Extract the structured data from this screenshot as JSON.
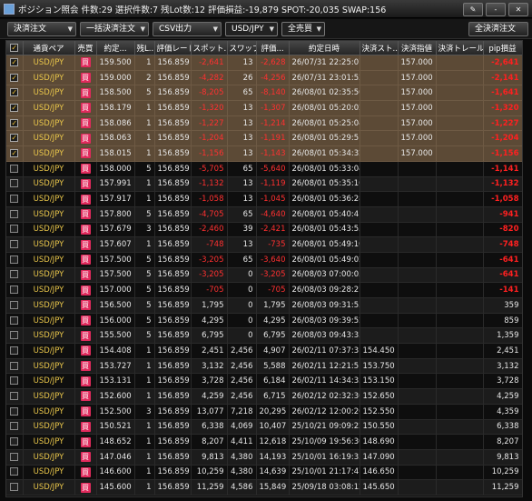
{
  "window": {
    "title": "ポジション照会  件数:29  選択件数:7  残Lot数:12  評価損益:-19,879  SPOT:-20,035  SWAP:156",
    "buttons": [
      "✎",
      "-",
      "✕"
    ]
  },
  "toolbar": {
    "settle_order": "決済注文",
    "bulk_settle": "一括決済注文",
    "csv_export": "CSV出力",
    "pair_filter": "USD/JPY",
    "side_filter": "全売買",
    "all_settle": "全決済注文"
  },
  "columns": [
    "",
    "通貨ペア",
    "売買",
    "約定...",
    "残L...",
    "評価レート",
    "スポット...",
    "スワップ",
    "評価...",
    "約定日時",
    "決済スト...",
    "決済指値",
    "決済トレール",
    "pip損益"
  ],
  "rows": [
    {
      "sel": true,
      "pair": "USD/JPY",
      "side": "買",
      "price": "159.500",
      "lot": "1",
      "rate": "156.859",
      "spot": "-2,641",
      "swap": "13",
      "eval": "-2,628",
      "date": "26/07/31 22:25:07",
      "stop": "",
      "limit": "157.000",
      "trail": "",
      "pip": "-2,641"
    },
    {
      "sel": true,
      "pair": "USD/JPY",
      "side": "買",
      "price": "159.000",
      "lot": "2",
      "rate": "156.859",
      "spot": "-4,282",
      "swap": "26",
      "eval": "-4,256",
      "date": "26/07/31 23:01:52",
      "stop": "",
      "limit": "157.000",
      "trail": "",
      "pip": "-2,141"
    },
    {
      "sel": true,
      "pair": "USD/JPY",
      "side": "買",
      "price": "158.500",
      "lot": "5",
      "rate": "156.859",
      "spot": "-8,205",
      "swap": "65",
      "eval": "-8,140",
      "date": "26/08/01 02:35:50",
      "stop": "",
      "limit": "157.000",
      "trail": "",
      "pip": "-1,641"
    },
    {
      "sel": true,
      "pair": "USD/JPY",
      "side": "買",
      "price": "158.179",
      "lot": "1",
      "rate": "156.859",
      "spot": "-1,320",
      "swap": "13",
      "eval": "-1,307",
      "date": "26/08/01 05:20:02",
      "stop": "",
      "limit": "157.000",
      "trail": "",
      "pip": "-1,320"
    },
    {
      "sel": true,
      "pair": "USD/JPY",
      "side": "買",
      "price": "158.086",
      "lot": "1",
      "rate": "156.859",
      "spot": "-1,227",
      "swap": "13",
      "eval": "-1,214",
      "date": "26/08/01 05:25:04",
      "stop": "",
      "limit": "157.000",
      "trail": "",
      "pip": "-1,227"
    },
    {
      "sel": true,
      "pair": "USD/JPY",
      "side": "買",
      "price": "158.063",
      "lot": "1",
      "rate": "156.859",
      "spot": "-1,204",
      "swap": "13",
      "eval": "-1,191",
      "date": "26/08/01 05:29:51",
      "stop": "",
      "limit": "157.000",
      "trail": "",
      "pip": "-1,204"
    },
    {
      "sel": true,
      "pair": "USD/JPY",
      "side": "買",
      "price": "158.015",
      "lot": "1",
      "rate": "156.859",
      "spot": "-1,156",
      "swap": "13",
      "eval": "-1,143",
      "date": "26/08/01 05:34:32",
      "stop": "",
      "limit": "157.000",
      "trail": "",
      "pip": "-1,156"
    },
    {
      "sel": false,
      "pair": "USD/JPY",
      "side": "買",
      "price": "158.000",
      "lot": "5",
      "rate": "156.859",
      "spot": "-5,705",
      "swap": "65",
      "eval": "-5,640",
      "date": "26/08/01 05:33:04",
      "stop": "",
      "limit": "",
      "trail": "",
      "pip": "-1,141"
    },
    {
      "sel": false,
      "pair": "USD/JPY",
      "side": "買",
      "price": "157.991",
      "lot": "1",
      "rate": "156.859",
      "spot": "-1,132",
      "swap": "13",
      "eval": "-1,119",
      "date": "26/08/01 05:35:16",
      "stop": "",
      "limit": "",
      "trail": "",
      "pip": "-1,132"
    },
    {
      "sel": false,
      "pair": "USD/JPY",
      "side": "買",
      "price": "157.917",
      "lot": "1",
      "rate": "156.859",
      "spot": "-1,058",
      "swap": "13",
      "eval": "-1,045",
      "date": "26/08/01 05:36:28",
      "stop": "",
      "limit": "",
      "trail": "",
      "pip": "-1,058"
    },
    {
      "sel": false,
      "pair": "USD/JPY",
      "side": "買",
      "price": "157.800",
      "lot": "5",
      "rate": "156.859",
      "spot": "-4,705",
      "swap": "65",
      "eval": "-4,640",
      "date": "26/08/01 05:40:41",
      "stop": "",
      "limit": "",
      "trail": "",
      "pip": "-941"
    },
    {
      "sel": false,
      "pair": "USD/JPY",
      "side": "買",
      "price": "157.679",
      "lot": "3",
      "rate": "156.859",
      "spot": "-2,460",
      "swap": "39",
      "eval": "-2,421",
      "date": "26/08/01 05:43:53",
      "stop": "",
      "limit": "",
      "trail": "",
      "pip": "-820"
    },
    {
      "sel": false,
      "pair": "USD/JPY",
      "side": "買",
      "price": "157.607",
      "lot": "1",
      "rate": "156.859",
      "spot": "-748",
      "swap": "13",
      "eval": "-735",
      "date": "26/08/01 05:49:10",
      "stop": "",
      "limit": "",
      "trail": "",
      "pip": "-748"
    },
    {
      "sel": false,
      "pair": "USD/JPY",
      "side": "買",
      "price": "157.500",
      "lot": "5",
      "rate": "156.859",
      "spot": "-3,205",
      "swap": "65",
      "eval": "-3,640",
      "date": "26/08/01 05:49:02",
      "stop": "",
      "limit": "",
      "trail": "",
      "pip": "-641"
    },
    {
      "sel": false,
      "pair": "USD/JPY",
      "side": "買",
      "price": "157.500",
      "lot": "5",
      "rate": "156.859",
      "spot": "-3,205",
      "swap": "0",
      "eval": "-3,205",
      "date": "26/08/03 07:00:05",
      "stop": "",
      "limit": "",
      "trail": "",
      "pip": "-641"
    },
    {
      "sel": false,
      "pair": "USD/JPY",
      "side": "買",
      "price": "157.000",
      "lot": "5",
      "rate": "156.859",
      "spot": "-705",
      "swap": "0",
      "eval": "-705",
      "date": "26/08/03 09:28:27",
      "stop": "",
      "limit": "",
      "trail": "",
      "pip": "-141"
    },
    {
      "sel": false,
      "pair": "USD/JPY",
      "side": "買",
      "price": "156.500",
      "lot": "5",
      "rate": "156.859",
      "spot": "1,795",
      "swap": "0",
      "eval": "1,795",
      "date": "26/08/03 09:31:53",
      "stop": "",
      "limit": "",
      "trail": "",
      "pip": "359"
    },
    {
      "sel": false,
      "pair": "USD/JPY",
      "side": "買",
      "price": "156.000",
      "lot": "5",
      "rate": "156.859",
      "spot": "4,295",
      "swap": "0",
      "eval": "4,295",
      "date": "26/08/03 09:39:52",
      "stop": "",
      "limit": "",
      "trail": "",
      "pip": "859"
    },
    {
      "sel": false,
      "pair": "USD/JPY",
      "side": "買",
      "price": "155.500",
      "lot": "5",
      "rate": "156.859",
      "spot": "6,795",
      "swap": "0",
      "eval": "6,795",
      "date": "26/08/03 09:43:33",
      "stop": "",
      "limit": "",
      "trail": "",
      "pip": "1,359"
    },
    {
      "sel": false,
      "pair": "USD/JPY",
      "side": "買",
      "price": "154.408",
      "lot": "1",
      "rate": "156.859",
      "spot": "2,451",
      "swap": "2,456",
      "eval": "4,907",
      "date": "26/02/11 07:37:31",
      "stop": "154.450",
      "limit": "",
      "trail": "",
      "pip": "2,451"
    },
    {
      "sel": false,
      "pair": "USD/JPY",
      "side": "買",
      "price": "153.727",
      "lot": "1",
      "rate": "156.859",
      "spot": "3,132",
      "swap": "2,456",
      "eval": "5,588",
      "date": "26/02/11 12:21:51",
      "stop": "153.750",
      "limit": "",
      "trail": "",
      "pip": "3,132"
    },
    {
      "sel": false,
      "pair": "USD/JPY",
      "side": "買",
      "price": "153.131",
      "lot": "1",
      "rate": "156.859",
      "spot": "3,728",
      "swap": "2,456",
      "eval": "6,184",
      "date": "26/02/11 14:34:35",
      "stop": "153.150",
      "limit": "",
      "trail": "",
      "pip": "3,728"
    },
    {
      "sel": false,
      "pair": "USD/JPY",
      "side": "買",
      "price": "152.600",
      "lot": "1",
      "rate": "156.859",
      "spot": "4,259",
      "swap": "2,456",
      "eval": "6,715",
      "date": "26/02/12 02:32:36",
      "stop": "152.650",
      "limit": "",
      "trail": "",
      "pip": "4,259"
    },
    {
      "sel": false,
      "pair": "USD/JPY",
      "side": "買",
      "price": "152.500",
      "lot": "3",
      "rate": "156.859",
      "spot": "13,077",
      "swap": "7,218",
      "eval": "20,295",
      "date": "26/02/12 12:00:26",
      "stop": "152.550",
      "limit": "",
      "trail": "",
      "pip": "4,359"
    },
    {
      "sel": false,
      "pair": "USD/JPY",
      "side": "買",
      "price": "150.521",
      "lot": "1",
      "rate": "156.859",
      "spot": "6,338",
      "swap": "4,069",
      "eval": "10,407",
      "date": "25/10/21 09:09:22",
      "stop": "150.550",
      "limit": "",
      "trail": "",
      "pip": "6,338"
    },
    {
      "sel": false,
      "pair": "USD/JPY",
      "side": "買",
      "price": "148.652",
      "lot": "1",
      "rate": "156.859",
      "spot": "8,207",
      "swap": "4,411",
      "eval": "12,618",
      "date": "25/10/09 19:56:30",
      "stop": "148.690",
      "limit": "",
      "trail": "",
      "pip": "8,207"
    },
    {
      "sel": false,
      "pair": "USD/JPY",
      "side": "買",
      "price": "147.046",
      "lot": "1",
      "rate": "156.859",
      "spot": "9,813",
      "swap": "4,380",
      "eval": "14,193",
      "date": "25/10/01 16:19:33",
      "stop": "147.090",
      "limit": "",
      "trail": "",
      "pip": "9,813"
    },
    {
      "sel": false,
      "pair": "USD/JPY",
      "side": "買",
      "price": "146.600",
      "lot": "1",
      "rate": "156.859",
      "spot": "10,259",
      "swap": "4,380",
      "eval": "14,639",
      "date": "25/10/01 21:17:47",
      "stop": "146.650",
      "limit": "",
      "trail": "",
      "pip": "10,259"
    },
    {
      "sel": false,
      "pair": "USD/JPY",
      "side": "買",
      "price": "145.600",
      "lot": "1",
      "rate": "156.859",
      "spot": "11,259",
      "swap": "4,586",
      "eval": "15,849",
      "date": "25/09/18 03:08:12",
      "stop": "145.650",
      "limit": "",
      "trail": "",
      "pip": "11,259"
    }
  ]
}
